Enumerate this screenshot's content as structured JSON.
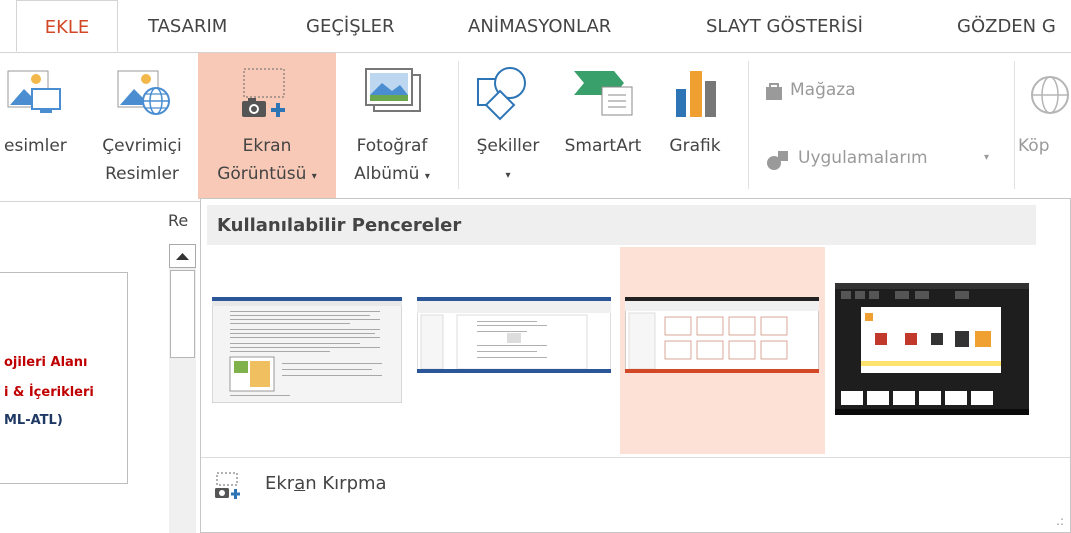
{
  "tabs": [
    {
      "label": "EKLE",
      "active": true
    },
    {
      "label": "TASARIM"
    },
    {
      "label": "GEÇİŞLER"
    },
    {
      "label": "ANİMASYONLAR"
    },
    {
      "label": "SLAYT GÖSTERİSİ"
    },
    {
      "label": "GÖZDEN G"
    }
  ],
  "ribbon": {
    "resimler": {
      "label": "esimler"
    },
    "cevrimici": {
      "line1": "Çevrimiçi",
      "line2": "Resimler"
    },
    "ekran": {
      "line1": "Ekran",
      "line2": "Görüntüsü"
    },
    "fotograf": {
      "line1": "Fotoğraf",
      "line2": "Albümü"
    },
    "sekiller": {
      "label": "Şekiller"
    },
    "smartart": {
      "label": "SmartArt"
    },
    "grafik": {
      "label": "Grafik"
    },
    "magaza": {
      "label": "Mağaza"
    },
    "uygulamalarim": {
      "label": "Uygulamalarım"
    },
    "kop": {
      "label": "Köp"
    },
    "group_label": "Re",
    "dropdown_arrow": "▾"
  },
  "slide_thumb": {
    "line1": "ojileri Alanı",
    "line2": "i & İçerikleri",
    "line3": "ML-ATL)"
  },
  "dropdown": {
    "header": "Kullanılabilir Pencereler",
    "screen_clipping": {
      "pre": "Ekr",
      "underlined": "a",
      "post": "n Kırpma"
    },
    "grip": ".:"
  },
  "colors": {
    "accent": "#d24726",
    "highlight": "#f8c9b6",
    "selected_window": "#fde0d6"
  }
}
